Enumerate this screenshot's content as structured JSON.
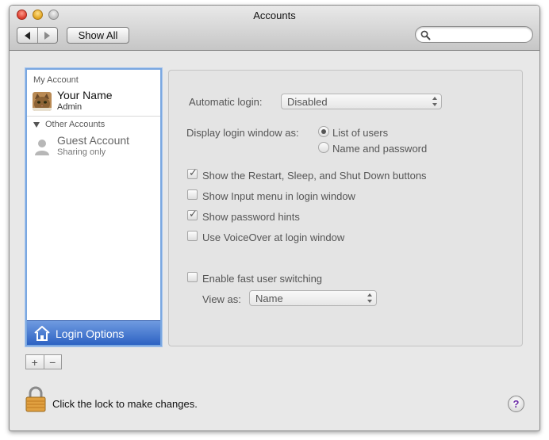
{
  "window": {
    "title": "Accounts"
  },
  "toolbar": {
    "back_icon": "back-arrow-icon",
    "forward_icon": "forward-arrow-icon",
    "show_all_label": "Show All",
    "search_value": "",
    "search_icon": "magnifier-icon"
  },
  "sidebar": {
    "my_account_header": "My Account",
    "my_account": {
      "name": "Your Name",
      "role": "Admin",
      "avatar_icon": "cat-photo-icon"
    },
    "other_accounts_header": "Other Accounts",
    "guest": {
      "name": "Guest Account",
      "role": "Sharing only",
      "avatar_icon": "person-silhouette-icon"
    },
    "login_options_label": "Login Options",
    "login_options_icon": "house-icon",
    "selected_color": "#2d62c3",
    "add_label": "+",
    "remove_label": "−"
  },
  "login_options": {
    "automatic_login_label": "Automatic login:",
    "automatic_login_value": "Disabled",
    "display_login_label": "Display login window as:",
    "display_options": [
      {
        "label": "List of users",
        "selected": true
      },
      {
        "label": "Name and password",
        "selected": false
      }
    ],
    "checkboxes": [
      {
        "label": "Show the Restart, Sleep, and Shut Down buttons",
        "checked": true
      },
      {
        "label": "Show Input menu in login window",
        "checked": false
      },
      {
        "label": "Show password hints",
        "checked": true
      },
      {
        "label": "Use VoiceOver at login window",
        "checked": false
      }
    ],
    "fast_switching": {
      "label": "Enable fast user switching",
      "checked": false
    },
    "view_as_label": "View as:",
    "view_as_value": "Name"
  },
  "footer": {
    "lock_label": "Click the lock to make changes.",
    "lock_icon": "padlock-icon",
    "help_label": "?",
    "help_icon": "help-question-icon"
  }
}
